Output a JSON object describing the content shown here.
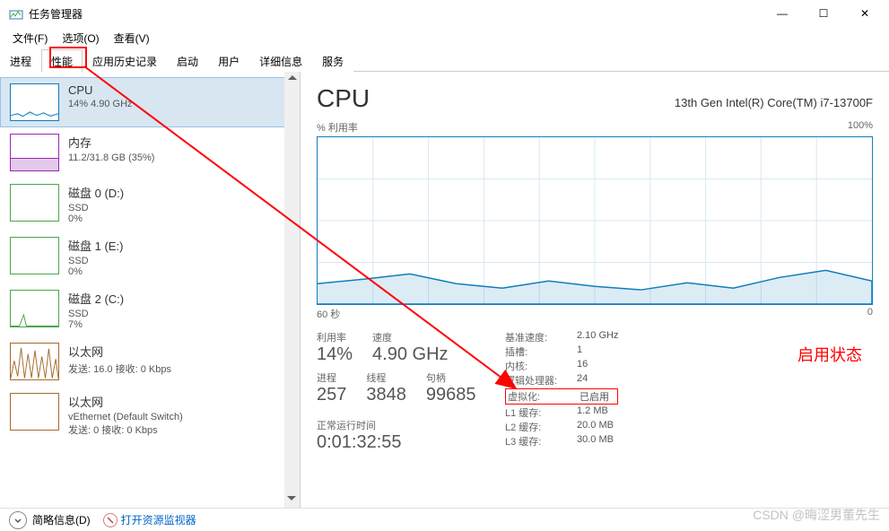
{
  "window": {
    "title": "任务管理器"
  },
  "controls": {
    "min": "—",
    "max": "☐",
    "close": "✕"
  },
  "menu": {
    "file": "文件(F)",
    "options": "选项(O)",
    "view": "查看(V)"
  },
  "tabs": {
    "processes": "进程",
    "performance": "性能",
    "app_history": "应用历史记录",
    "startup": "启动",
    "users": "用户",
    "details": "详细信息",
    "services": "服务"
  },
  "sidebar": {
    "cpu": {
      "title": "CPU",
      "sub": "14% 4.90 GHz"
    },
    "memory": {
      "title": "内存",
      "sub": "11.2/31.8 GB (35%)"
    },
    "disk0": {
      "title": "磁盘 0 (D:)",
      "sub": "SSD",
      "pct": "0%"
    },
    "disk1": {
      "title": "磁盘 1 (E:)",
      "sub": "SSD",
      "pct": "0%"
    },
    "disk2": {
      "title": "磁盘 2 (C:)",
      "sub": "SSD",
      "pct": "7%"
    },
    "eth1": {
      "title": "以太网",
      "send": "发送: 16.0 接收: 0 Kbps"
    },
    "eth2": {
      "title": "以太网",
      "sub": "vEthernet (Default Switch)",
      "send": "发送: 0 接收: 0 Kbps"
    }
  },
  "main": {
    "title": "CPU",
    "model": "13th Gen Intel(R) Core(TM) i7-13700F",
    "chart_top_left": "% 利用率",
    "chart_top_right": "100%",
    "chart_bottom_left": "60 秒",
    "chart_bottom_right": "0",
    "stats": {
      "util_lbl": "利用率",
      "util_val": "14%",
      "speed_lbl": "速度",
      "speed_val": "4.90 GHz",
      "proc_lbl": "进程",
      "proc_val": "257",
      "thread_lbl": "线程",
      "thread_val": "3848",
      "handle_lbl": "句柄",
      "handle_val": "99685",
      "uptime_lbl": "正常运行时间",
      "uptime_val": "0:01:32:55"
    },
    "info": {
      "base_speed_k": "基准速度:",
      "base_speed_v": "2.10 GHz",
      "sockets_k": "插槽:",
      "sockets_v": "1",
      "cores_k": "内核:",
      "cores_v": "16",
      "logical_k": "逻辑处理器:",
      "logical_v": "24",
      "virt_k": "虚拟化:",
      "virt_v": "已启用",
      "l1_k": "L1 缓存:",
      "l1_v": "1.2 MB",
      "l2_k": "L2 缓存:",
      "l2_v": "20.0 MB",
      "l3_k": "L3 缓存:",
      "l3_v": "30.0 MB"
    }
  },
  "footer": {
    "brief": "简略信息(D)",
    "resmon": "打开资源监视器"
  },
  "annotation": {
    "status": "启用状态"
  },
  "watermark": "CSDN @晦涩男董先生",
  "chart_data": {
    "type": "line",
    "title": "% 利用率",
    "xlabel": "60 秒 → 0",
    "ylabel": "%",
    "ylim": [
      0,
      100
    ],
    "x": [
      0,
      5,
      10,
      15,
      20,
      25,
      30,
      35,
      40,
      45,
      50,
      55,
      60
    ],
    "values": [
      12,
      15,
      18,
      12,
      10,
      14,
      11,
      9,
      13,
      10,
      16,
      20,
      14
    ]
  }
}
